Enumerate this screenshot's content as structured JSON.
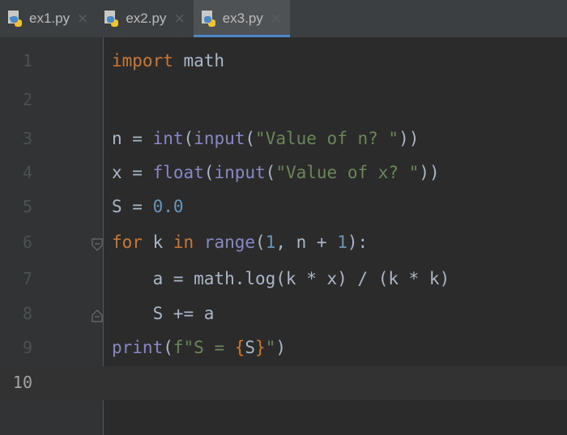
{
  "tabs": [
    {
      "name": "ex1.py",
      "active": false
    },
    {
      "name": "ex2.py",
      "active": false
    },
    {
      "name": "ex3.py",
      "active": true
    }
  ],
  "tab_close_glyph": "×",
  "current_line": 10,
  "line_numbers": [
    "1",
    "2",
    "3",
    "4",
    "5",
    "6",
    "7",
    "8",
    "9",
    "10"
  ],
  "code": {
    "l1": {
      "kw": "import",
      "rest": " math"
    },
    "l3": {
      "a": "n = ",
      "b1": "int",
      "b2": "(",
      "b3": "input",
      "b4": "(",
      "s": "\"Value of n? \"",
      "e": "))"
    },
    "l4": {
      "a": "x = ",
      "b1": "float",
      "b2": "(",
      "b3": "input",
      "b4": "(",
      "s": "\"Value of x? \"",
      "e": "))"
    },
    "l5": {
      "a": "S = ",
      "n": "0.0"
    },
    "l6": {
      "kw": "for",
      "a": " k ",
      "kw2": "in",
      "b": " ",
      "bi": "range",
      "c": "(",
      "n": "1",
      "d": ", n + ",
      "n2": "1",
      "e": "):"
    },
    "l7": {
      "text": "    a = math.log(k * x) / (k * k)"
    },
    "l8": {
      "text": "    S += a"
    },
    "l9": {
      "bi": "print",
      "a": "(",
      "s1": "f\"S = ",
      "br1": "{",
      "v": "S",
      "br2": "}",
      "s2": "\"",
      "e": ")"
    }
  },
  "icon_names": [
    "python-file-icon",
    "tab-close-icon",
    "fold-start-icon",
    "fold-end-icon"
  ]
}
